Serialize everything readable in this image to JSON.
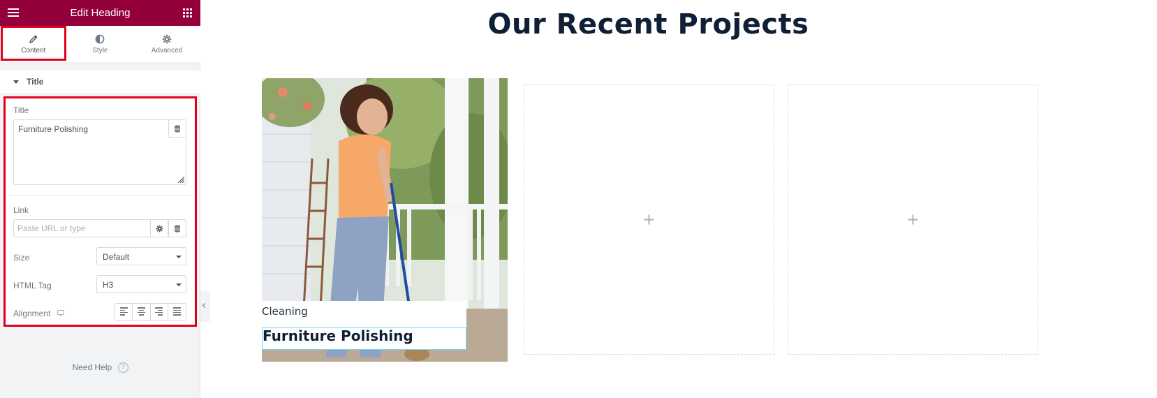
{
  "panel": {
    "title": "Edit Heading",
    "tabs": [
      {
        "label": "Content",
        "icon": "pencil-icon",
        "active": true
      },
      {
        "label": "Style",
        "icon": "contrast-icon",
        "active": false
      },
      {
        "label": "Advanced",
        "icon": "gear-icon",
        "active": false
      }
    ],
    "section": "Title",
    "controls": {
      "title_label": "Title",
      "title_value": "Furniture Polishing",
      "link_label": "Link",
      "link_placeholder": "Paste URL or type",
      "size_label": "Size",
      "size_value": "Default",
      "tag_label": "HTML Tag",
      "tag_value": "H3",
      "alignment_label": "Alignment"
    },
    "help": "Need Help",
    "help_icon": "?"
  },
  "canvas": {
    "heading": "Our Recent Projects",
    "project": {
      "category": "Cleaning",
      "name": "Furniture Polishing"
    },
    "empty_plus": "+"
  },
  "colors": {
    "panel_header": "#93003c",
    "highlight": "#e3001b",
    "heading": "#0f1f35"
  }
}
